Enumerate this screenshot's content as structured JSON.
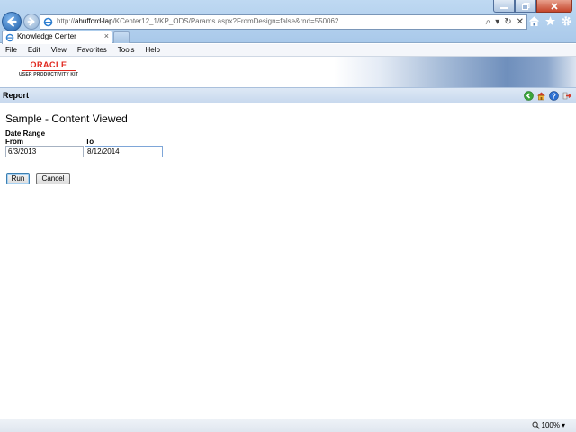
{
  "browser": {
    "url_prefix": "http://",
    "url_host": "ahufford-lap",
    "url_path": "/KCenter12_1/KP_ODS/Params.aspx?FromDesign=false&rnd=550062",
    "tab_title": "Knowledge Center",
    "tab_close": "×",
    "zoom_label": "100%",
    "zoom_caret": "▾",
    "search_glyph": "⌕",
    "dropdown_glyph": "▾",
    "refresh_glyph": "↻",
    "stop_glyph": "✕"
  },
  "menu": [
    "File",
    "Edit",
    "View",
    "Favorites",
    "Tools",
    "Help"
  ],
  "logo": {
    "brand": "ORACLE",
    "product": "USER PRODUCTIVITY KIT"
  },
  "report_bar": {
    "label": "Report"
  },
  "form": {
    "title": "Sample - Content Viewed",
    "group_label": "Date Range",
    "from_label": "From",
    "to_label": "To",
    "from_value": "6/3/2013",
    "to_value": "8/12/2014",
    "run_label": "Run",
    "cancel_label": "Cancel"
  },
  "icons": {
    "back": "back-arrow-icon",
    "forward": "forward-arrow-icon",
    "home": "home-icon",
    "favorites": "star-icon",
    "tools": "gear-icon",
    "report_back": "green-back-icon",
    "report_home": "home-icon",
    "report_help": "help-icon",
    "report_exit": "exit-icon"
  },
  "colors": {
    "oracle_red": "#e0261c",
    "chrome_blue": "#a9c9ea",
    "report_bar": "#c8d9ee"
  }
}
